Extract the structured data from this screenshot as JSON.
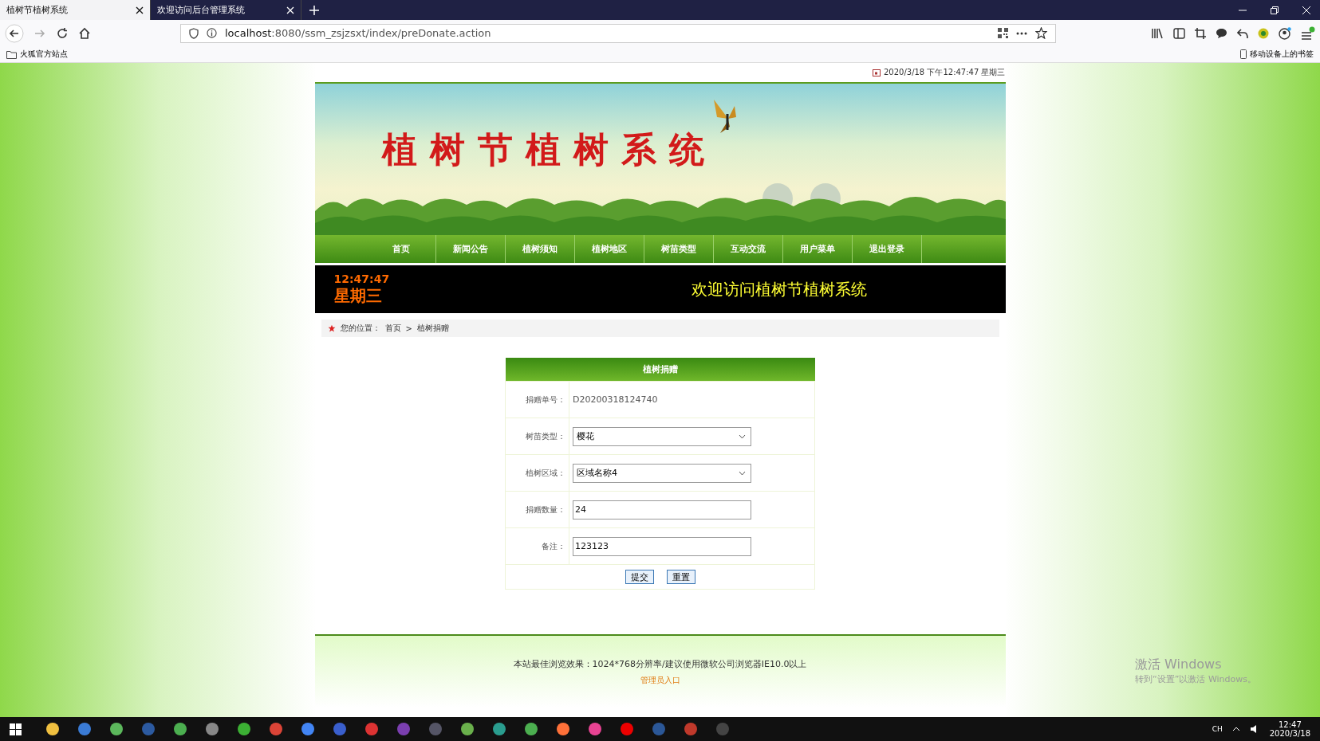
{
  "browser": {
    "tabs": [
      {
        "title": "植树节植树系统",
        "selected": true
      },
      {
        "title": "欢迎访问后台管理系统",
        "selected": false
      }
    ],
    "url_host": "localhost",
    "url_rest": ":8080/ssm_zsjzsxt/index/preDonate.action",
    "bookmark": "火狐官方站点",
    "mobile_bookmarks": "移动设备上的书签"
  },
  "page": {
    "datetime": "2020/3/18 下午12:47:47 星期三",
    "site_title": "植树节植树系统",
    "nav": [
      "首页",
      "新闻公告",
      "植树须知",
      "植树地区",
      "树苗类型",
      "互动交流",
      "用户菜单",
      "退出登录"
    ],
    "clock_time": "12:47:47",
    "clock_weekday": "星期三",
    "welcome": "欢迎访问植树节植树系统",
    "breadcrumb": {
      "label": "您的位置：",
      "items": [
        "首页",
        "植树捐赠"
      ],
      "separator": ">"
    }
  },
  "form": {
    "title": "植树捐赠",
    "rows": [
      {
        "label": "捐赠单号：",
        "kind": "text",
        "value": "D20200318124740"
      },
      {
        "label": "树苗类型：",
        "kind": "select",
        "value": "樱花"
      },
      {
        "label": "植树区域：",
        "kind": "select",
        "value": "区域名称4"
      },
      {
        "label": "捐赠数量：",
        "kind": "input",
        "value": "24"
      },
      {
        "label": "备注：",
        "kind": "input",
        "value": "123123"
      }
    ],
    "buttons": [
      "提交",
      "重置"
    ]
  },
  "footer": {
    "note": "本站最佳浏览效果：1024*768分辨率/建议使用微软公司浏览器IE10.0以上",
    "admin_link": "管理员入口"
  },
  "activation": {
    "title": "激活 Windows",
    "subtitle": "转到“设置”以激活 Windows。"
  },
  "taskbar": {
    "language": "CH",
    "time": "12:47",
    "date": "2020/3/18"
  }
}
